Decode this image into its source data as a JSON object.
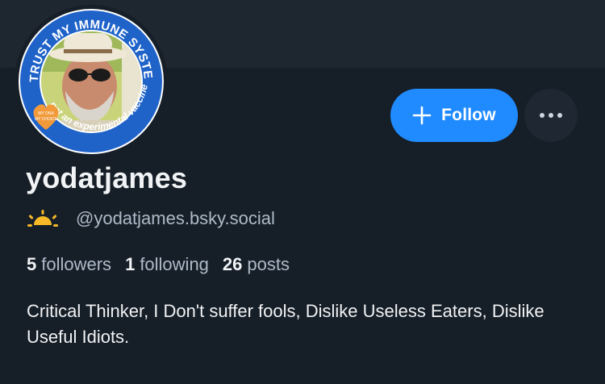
{
  "profile": {
    "display_name": "yodatjames",
    "handle": "@yodatjames.bsky.social",
    "bio": "Critical Thinker, I Don't suffer fools, Dislike Useless Eaters, Dislike Useful Idiots.",
    "handle_badge_icon": "sun-icon"
  },
  "avatar_badge": {
    "top_text": "I TRUST MY IMMUNE SYSTEM",
    "bottom_text": "not an experimental vaccine",
    "heart_text_line1": "MY DNA",
    "heart_text_line2": "MY CHOICE"
  },
  "stats": {
    "followers_count": "5",
    "followers_label": "followers",
    "following_count": "1",
    "following_label": "following",
    "posts_count": "26",
    "posts_label": "posts"
  },
  "actions": {
    "follow_label": "Follow",
    "follow_icon": "plus-icon",
    "more_icon": "ellipsis-icon"
  },
  "colors": {
    "background": "#161e27",
    "banner": "#1e2630",
    "accent": "#208bfe",
    "muted_text": "#aebbc9",
    "badge_blue": "#1f63c9",
    "badge_orange": "#f29a3a"
  }
}
